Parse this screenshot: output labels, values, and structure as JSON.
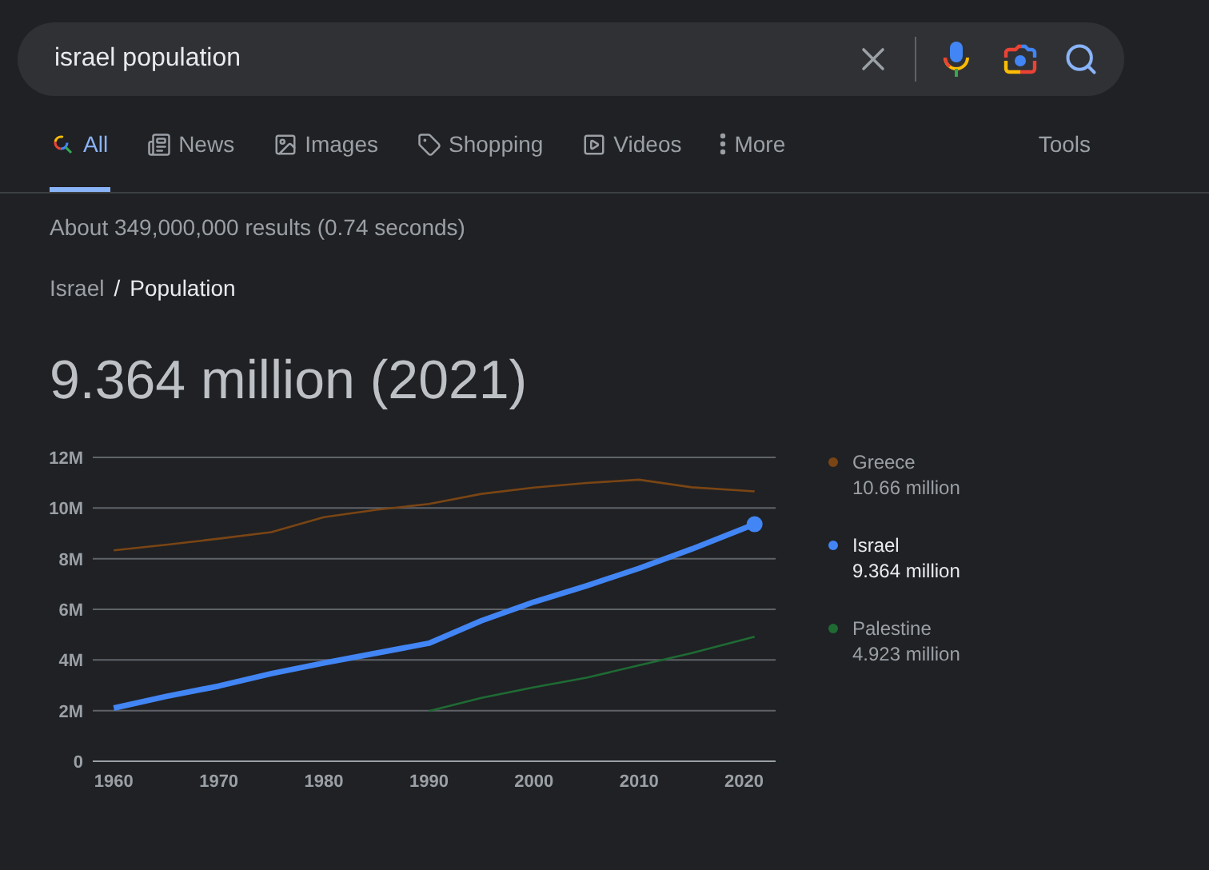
{
  "search": {
    "value": "israel population"
  },
  "tabs": [
    {
      "label": "All",
      "kind": "all",
      "selected": true
    },
    {
      "label": "News",
      "kind": "news",
      "selected": false
    },
    {
      "label": "Images",
      "kind": "images",
      "selected": false
    },
    {
      "label": "Shopping",
      "kind": "shopping",
      "selected": false
    },
    {
      "label": "Videos",
      "kind": "videos",
      "selected": false
    },
    {
      "label": "More",
      "kind": "more",
      "selected": false
    }
  ],
  "tools": "Tools",
  "result_stats": "About 349,000,000 results (0.74 seconds)",
  "breadcrumb": {
    "parent": "Israel",
    "separator": "/",
    "current": "Population"
  },
  "headline": "9.364 million (2021)",
  "chart": {
    "chart_data": {
      "type": "line",
      "x": [
        1960,
        1965,
        1970,
        1975,
        1980,
        1985,
        1990,
        1995,
        2000,
        2005,
        2010,
        2015,
        2021
      ],
      "ylim": [
        0,
        12000000
      ],
      "xlim": [
        1958,
        2023
      ],
      "grid": true,
      "legend": "right",
      "yticks": [
        {
          "value": 0,
          "label": "0"
        },
        {
          "value": 2000000,
          "label": "2M"
        },
        {
          "value": 4000000,
          "label": "4M"
        },
        {
          "value": 6000000,
          "label": "6M"
        },
        {
          "value": 8000000,
          "label": "8M"
        },
        {
          "value": 10000000,
          "label": "10M"
        },
        {
          "value": 12000000,
          "label": "12M"
        }
      ],
      "xticks": [
        1960,
        1970,
        1980,
        1990,
        2000,
        2010,
        2020
      ],
      "series": [
        {
          "name": "Greece",
          "color": "#7a4514",
          "values": [
            8330000,
            8550000,
            8790000,
            9050000,
            9640000,
            9930000,
            10160000,
            10560000,
            10810000,
            10990000,
            11120000,
            10820000,
            10660000
          ]
        },
        {
          "name": "Israel",
          "color": "#4285f4",
          "values": [
            2100000,
            2560000,
            2970000,
            3460000,
            3880000,
            4270000,
            4660000,
            5550000,
            6290000,
            6930000,
            7620000,
            8380000,
            9360000
          ]
        },
        {
          "name": "Palestine",
          "color": "#1e6b34",
          "values": [
            null,
            null,
            null,
            null,
            null,
            null,
            1980000,
            2500000,
            2920000,
            3300000,
            3790000,
            4270000,
            4920000
          ]
        }
      ]
    },
    "legend": [
      {
        "value": "10.66 million",
        "selected": false
      },
      {
        "value": "9.364 million",
        "selected": true
      },
      {
        "value": "4.923 million",
        "selected": false
      }
    ]
  }
}
